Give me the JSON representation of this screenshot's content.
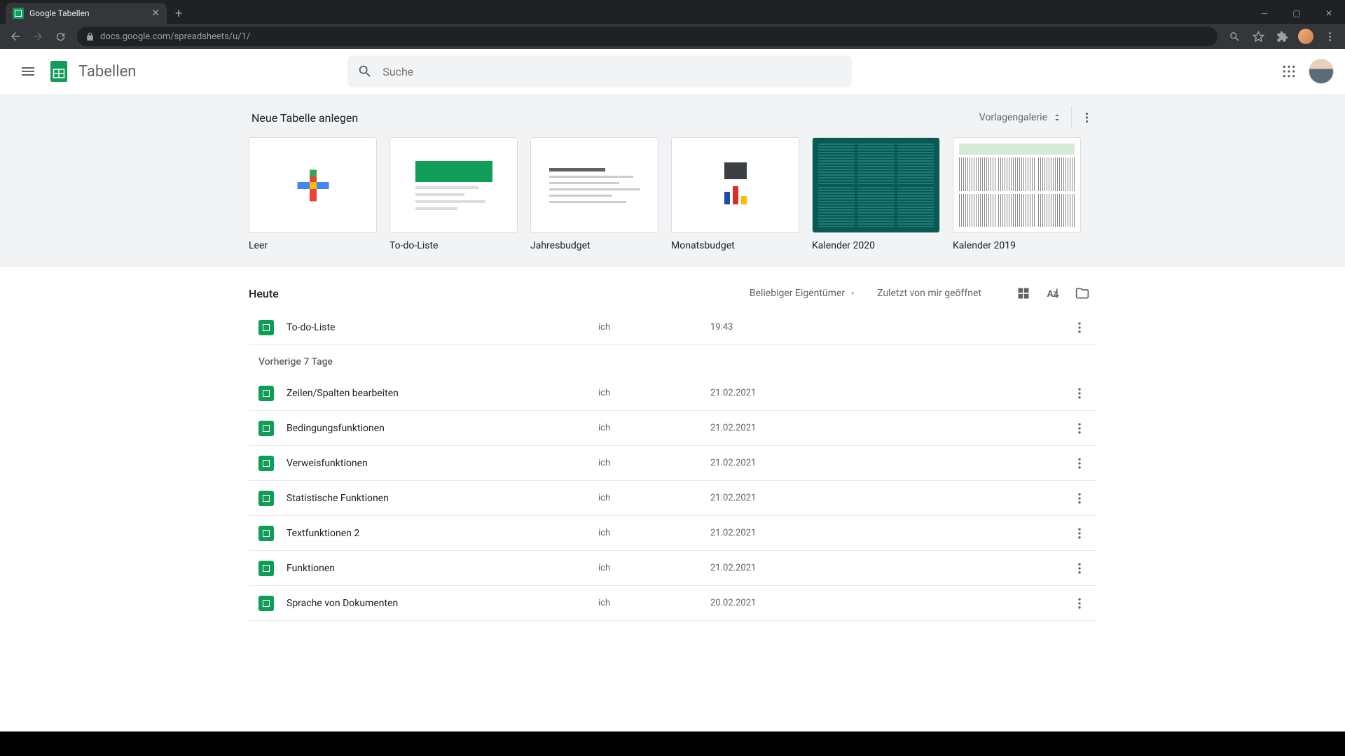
{
  "browser": {
    "tab_title": "Google Tabellen",
    "url": "docs.google.com/spreadsheets/u/1/"
  },
  "header": {
    "app_name": "Tabellen",
    "search_placeholder": "Suche"
  },
  "gallery": {
    "title": "Neue Tabelle anlegen",
    "link_label": "Vorlagengalerie",
    "templates": [
      {
        "label": "Leer"
      },
      {
        "label": "To-do-Liste"
      },
      {
        "label": "Jahresbudget"
      },
      {
        "label": "Monatsbudget"
      },
      {
        "label": "Kalender 2020"
      },
      {
        "label": "Kalender 2019"
      }
    ]
  },
  "docs": {
    "owner_filter": "Beliebiger Eigentümer",
    "opened_label": "Zuletzt von mir geöffnet",
    "sections": [
      {
        "label": "Heute",
        "rows": [
          {
            "name": "To-do-Liste",
            "owner": "ich",
            "date": "19:43"
          }
        ]
      },
      {
        "label": "Vorherige 7 Tage",
        "rows": [
          {
            "name": "Zeilen/Spalten bearbeiten",
            "owner": "ich",
            "date": "21.02.2021"
          },
          {
            "name": "Bedingungsfunktionen",
            "owner": "ich",
            "date": "21.02.2021"
          },
          {
            "name": "Verweisfunktionen",
            "owner": "ich",
            "date": "21.02.2021"
          },
          {
            "name": "Statistische Funktionen",
            "owner": "ich",
            "date": "21.02.2021"
          },
          {
            "name": "Textfunktionen 2",
            "owner": "ich",
            "date": "21.02.2021"
          },
          {
            "name": "Funktionen",
            "owner": "ich",
            "date": "21.02.2021"
          },
          {
            "name": "Sprache von Dokumenten",
            "owner": "ich",
            "date": "20.02.2021"
          }
        ]
      }
    ]
  }
}
